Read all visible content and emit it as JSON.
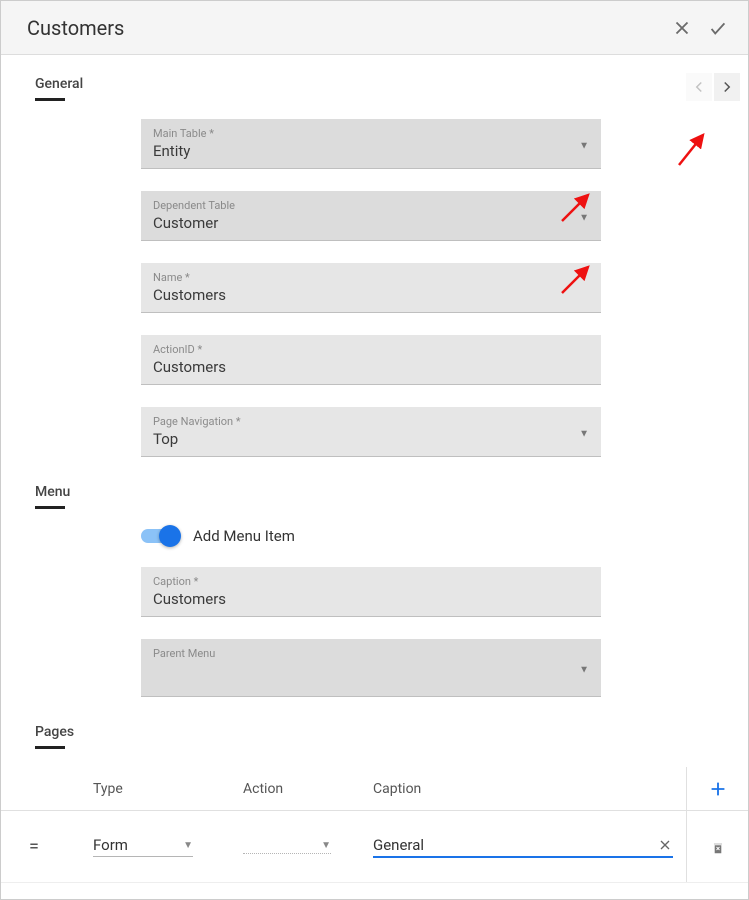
{
  "header": {
    "title": "Customers"
  },
  "sections": {
    "general": {
      "label": "General"
    },
    "menu": {
      "label": "Menu"
    },
    "pages": {
      "label": "Pages"
    }
  },
  "general": {
    "main_table": {
      "label": "Main Table *",
      "value": "Entity"
    },
    "dependent_table": {
      "label": "Dependent Table",
      "value": "Customer"
    },
    "name": {
      "label": "Name *",
      "value": "Customers"
    },
    "action_id": {
      "label": "ActionID *",
      "value": "Customers"
    },
    "page_nav": {
      "label": "Page Navigation *",
      "value": "Top"
    }
  },
  "menu": {
    "toggle_label": "Add Menu Item",
    "toggle_on": true,
    "caption": {
      "label": "Caption *",
      "value": "Customers"
    },
    "parent": {
      "label": "Parent Menu",
      "value": ""
    }
  },
  "pages": {
    "columns": {
      "type": "Type",
      "action": "Action",
      "caption": "Caption"
    },
    "rows": [
      {
        "type": "Form",
        "action": "",
        "caption": "General"
      }
    ]
  }
}
